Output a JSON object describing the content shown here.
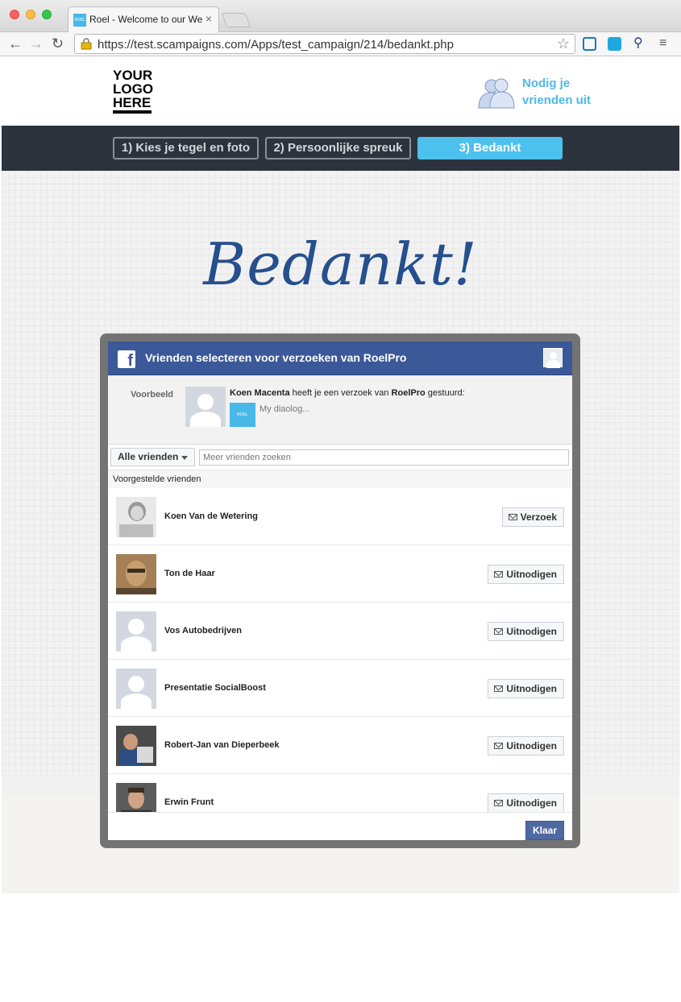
{
  "browser": {
    "tab_title": "Roel - Welcome to our Web",
    "tab_favicon_text": "ROEL",
    "url": "https://test.scampaigns.com/Apps/test_campaign/214/bedankt.php",
    "colors": {
      "accent": "#4dc1ee",
      "facebook": "#3b5998"
    }
  },
  "header": {
    "logo_lines": [
      "YOUR",
      "LOGO",
      "HERE"
    ],
    "invite_line1": "Nodig je",
    "invite_line2": "vrienden uit"
  },
  "steps": [
    {
      "label": "1) Kies je tegel en foto"
    },
    {
      "label": "2) Persoonlijke spreuk"
    },
    {
      "label": "3) Bedankt"
    }
  ],
  "main": {
    "heading": "Bedankt!"
  },
  "dialog": {
    "title": "Vrienden selecteren voor verzoeken van RoelPro",
    "preview_label": "Voorbeeld",
    "preview_sender": "Koen Macenta",
    "preview_text_mid": " heeft je een verzoek van ",
    "preview_app": "RoelPro",
    "preview_text_end": " gestuurd:",
    "preview_app_icon_text": "ROEL",
    "preview_message": "My diaolog...",
    "filter_label": "Alle vrienden",
    "search_placeholder": "Meer vrienden zoeken",
    "section_label": "Voorgestelde vrienden",
    "friends": [
      {
        "name": "Koen Van de Wetering",
        "action": "Verzoek"
      },
      {
        "name": "Ton de Haar",
        "action": "Uitnodigen"
      },
      {
        "name": "Vos Autobedrijven",
        "action": "Uitnodigen"
      },
      {
        "name": "Presentatie SocialBoost",
        "action": "Uitnodigen"
      },
      {
        "name": "Robert-Jan van Dieperbeek",
        "action": "Uitnodigen"
      },
      {
        "name": "Erwin Frunt",
        "action": "Uitnodigen"
      }
    ],
    "done_label": "Klaar"
  }
}
